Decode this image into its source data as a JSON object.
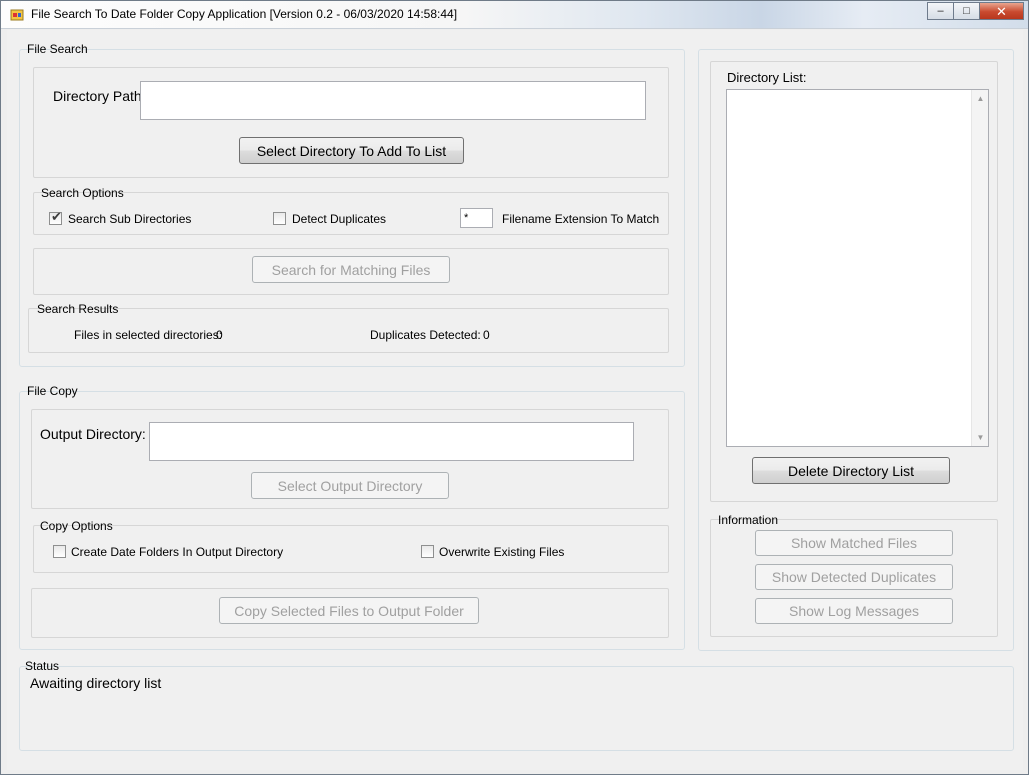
{
  "window": {
    "title": "File Search To Date Folder Copy Application [Version 0.2 - 06/03/2020 14:58:44]",
    "minimize_glyph": "–",
    "maximize_glyph": "□",
    "close_glyph": "✕"
  },
  "file_search": {
    "group_label": "File Search",
    "directory_path_label": "Directory Path:",
    "directory_path_value": "",
    "select_directory_button": "Select Directory To Add To List",
    "search_options": {
      "group_label": "Search Options",
      "search_sub_directories_label": "Search Sub Directories",
      "search_sub_directories_checked": true,
      "detect_duplicates_label": "Detect Duplicates",
      "detect_duplicates_checked": false,
      "extension_value": "*",
      "extension_label": "Filename Extension To Match"
    },
    "search_button": "Search for Matching Files",
    "search_results": {
      "group_label": "Search Results",
      "files_label": "Files in selected directories:",
      "files_value": "0",
      "duplicates_label": "Duplicates Detected:",
      "duplicates_value": "0"
    }
  },
  "file_copy": {
    "group_label": "File Copy",
    "output_directory_label": "Output Directory:",
    "output_directory_value": "",
    "select_output_button": "Select Output Directory",
    "copy_options": {
      "group_label": "Copy Options",
      "create_date_folders_label": "Create Date Folders In Output Directory",
      "create_date_folders_checked": false,
      "overwrite_label": "Overwrite Existing Files",
      "overwrite_checked": false
    },
    "copy_button": "Copy Selected Files to Output Folder"
  },
  "directory_list": {
    "label": "Directory List:",
    "items": [],
    "delete_button": "Delete Directory List"
  },
  "information": {
    "group_label": "Information",
    "show_matched_button": "Show Matched Files",
    "show_duplicates_button": "Show Detected Duplicates",
    "show_log_button": "Show Log Messages"
  },
  "status": {
    "group_label": "Status",
    "message": "Awaiting directory list"
  },
  "colors": {
    "window_bg": "#f0f0f0",
    "disabled_text": "#a0a0a0",
    "close_button": "#c94a2f"
  }
}
